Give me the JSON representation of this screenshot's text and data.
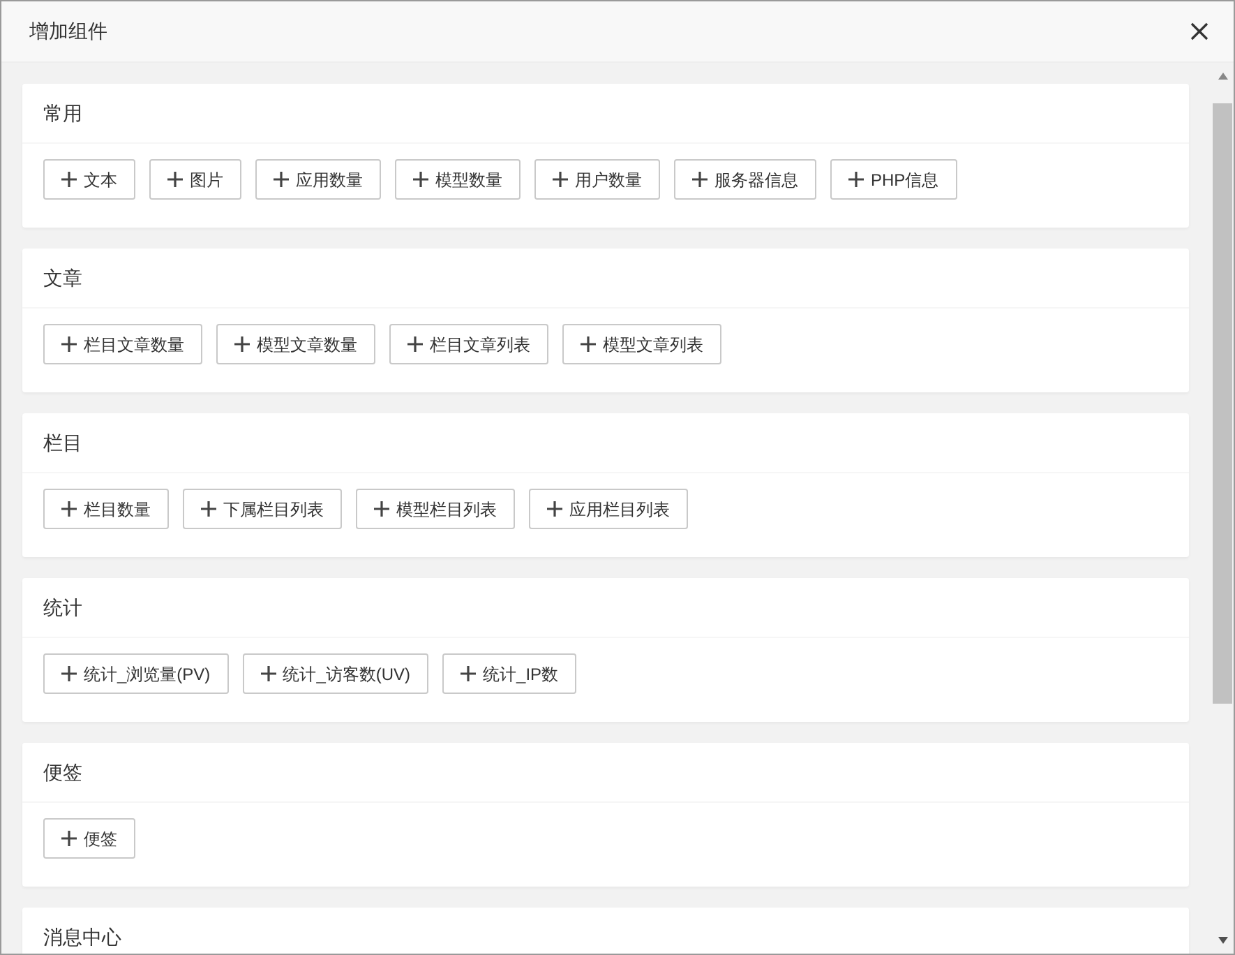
{
  "dialog": {
    "title": "增加组件"
  },
  "sections": [
    {
      "title": "常用",
      "buttons": [
        "文本",
        "图片",
        "应用数量",
        "模型数量",
        "用户数量",
        "服务器信息",
        "PHP信息"
      ]
    },
    {
      "title": "文章",
      "buttons": [
        "栏目文章数量",
        "模型文章数量",
        "栏目文章列表",
        "模型文章列表"
      ]
    },
    {
      "title": "栏目",
      "buttons": [
        "栏目数量",
        "下属栏目列表",
        "模型栏目列表",
        "应用栏目列表"
      ]
    },
    {
      "title": "统计",
      "buttons": [
        "统计_浏览量(PV)",
        "统计_访客数(UV)",
        "统计_IP数"
      ]
    },
    {
      "title": "便签",
      "buttons": [
        "便签"
      ]
    },
    {
      "title": "消息中心"
    }
  ]
}
